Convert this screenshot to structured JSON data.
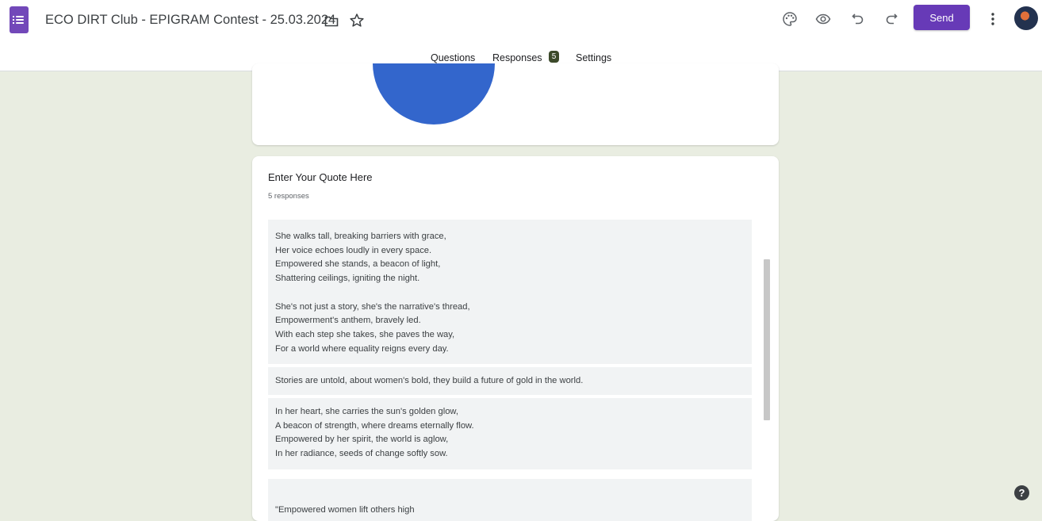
{
  "header": {
    "title": "ECO DIRT Club - EPIGRAM Contest - 25.03.2024",
    "send_label": "Send",
    "accent_color": "#673ab7",
    "icons": [
      "forms-logo-icon",
      "folder-icon",
      "star-icon",
      "palette-icon",
      "preview-eye-icon",
      "undo-icon",
      "redo-icon",
      "more-vert-icon",
      "avatar"
    ]
  },
  "tabs": {
    "questions": "Questions",
    "responses": "Responses",
    "responses_count": "5",
    "settings": "Settings",
    "active": "Responses"
  },
  "summary": {
    "pie_color": "#3366cc"
  },
  "question": {
    "title": "Enter Your Quote Here",
    "count": "5 responses",
    "answers": [
      "She walks tall, breaking barriers with grace,\nHer voice echoes loudly in every space.\nEmpowered she stands, a beacon of light,\nShattering ceilings, igniting the night.\n\nShe's not just a story, she's the narrative's thread,\nEmpowerment's anthem, bravely led.\nWith each step she takes, she paves the way,\nFor a world where equality reigns every day.",
      "Stories are untold, about women's bold, they build a future of gold in the world.",
      "In her heart, she carries the sun's golden glow,\nA beacon of strength, where dreams eternally flow.\nEmpowered by her spirit, the world is aglow,\nIn her radiance, seeds of change softly sow.",
      "\n\"Empowered women lift others high"
    ]
  },
  "help_label": "?"
}
